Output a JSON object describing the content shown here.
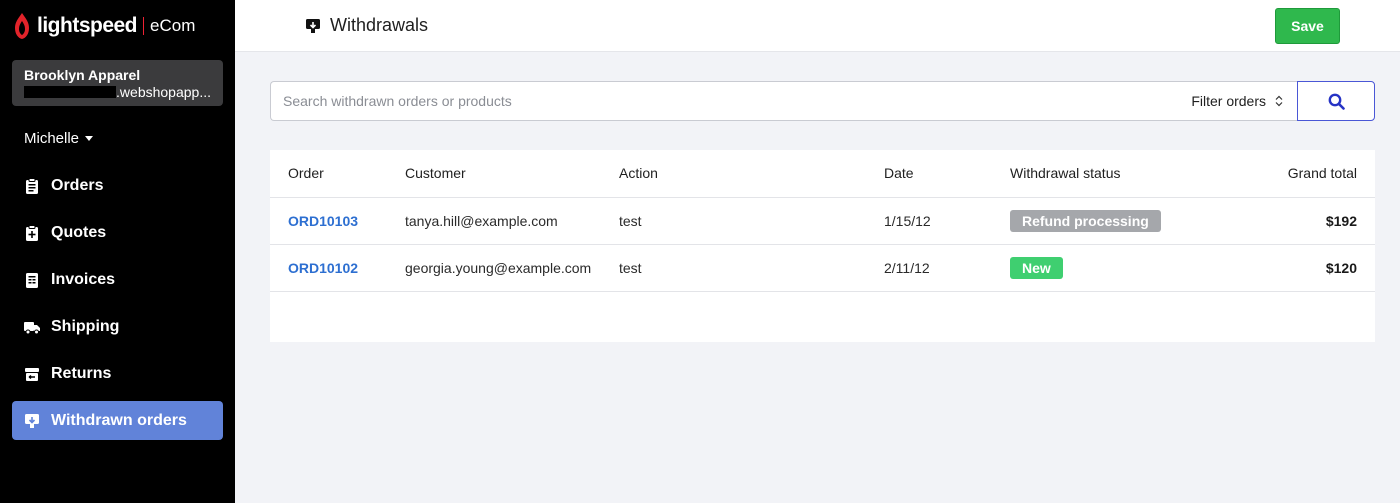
{
  "brand": {
    "name": "lightspeed",
    "product": "eCom"
  },
  "store": {
    "name": "Brooklyn Apparel",
    "url_suffix": ".webshopapp..."
  },
  "user": {
    "name": "Michelle"
  },
  "nav": [
    {
      "label": "Orders",
      "icon": "clipboard-icon",
      "active": false
    },
    {
      "label": "Quotes",
      "icon": "quote-clipboard-icon",
      "active": false
    },
    {
      "label": "Invoices",
      "icon": "invoice-icon",
      "active": false
    },
    {
      "label": "Shipping",
      "icon": "truck-icon",
      "active": false
    },
    {
      "label": "Returns",
      "icon": "returns-box-icon",
      "active": false
    },
    {
      "label": "Withdrawn orders",
      "icon": "withdraw-icon",
      "active": true
    }
  ],
  "header": {
    "title": "Withdrawals",
    "save_label": "Save"
  },
  "search": {
    "placeholder": "Search withdrawn orders or products",
    "value": "",
    "filter_label": "Filter orders"
  },
  "table": {
    "columns": [
      "Order",
      "Customer",
      "Action",
      "Date",
      "Withdrawal status",
      "Grand total"
    ],
    "rows": [
      {
        "order": "ORD10103",
        "customer": "tanya.hill@example.com",
        "action": "test",
        "date": "1/15/12",
        "status": "Refund processing",
        "status_color": "#a5a7ab",
        "total": "$192"
      },
      {
        "order": "ORD10102",
        "customer": "georgia.young@example.com",
        "action": "test",
        "date": "2/11/12",
        "status": "New",
        "status_color": "#3fcf70",
        "total": "$120"
      }
    ]
  },
  "colors": {
    "accent": "#6183d9",
    "save": "#2fb84d",
    "link": "#2d6fd1",
    "search_border": "#4a57d6"
  }
}
